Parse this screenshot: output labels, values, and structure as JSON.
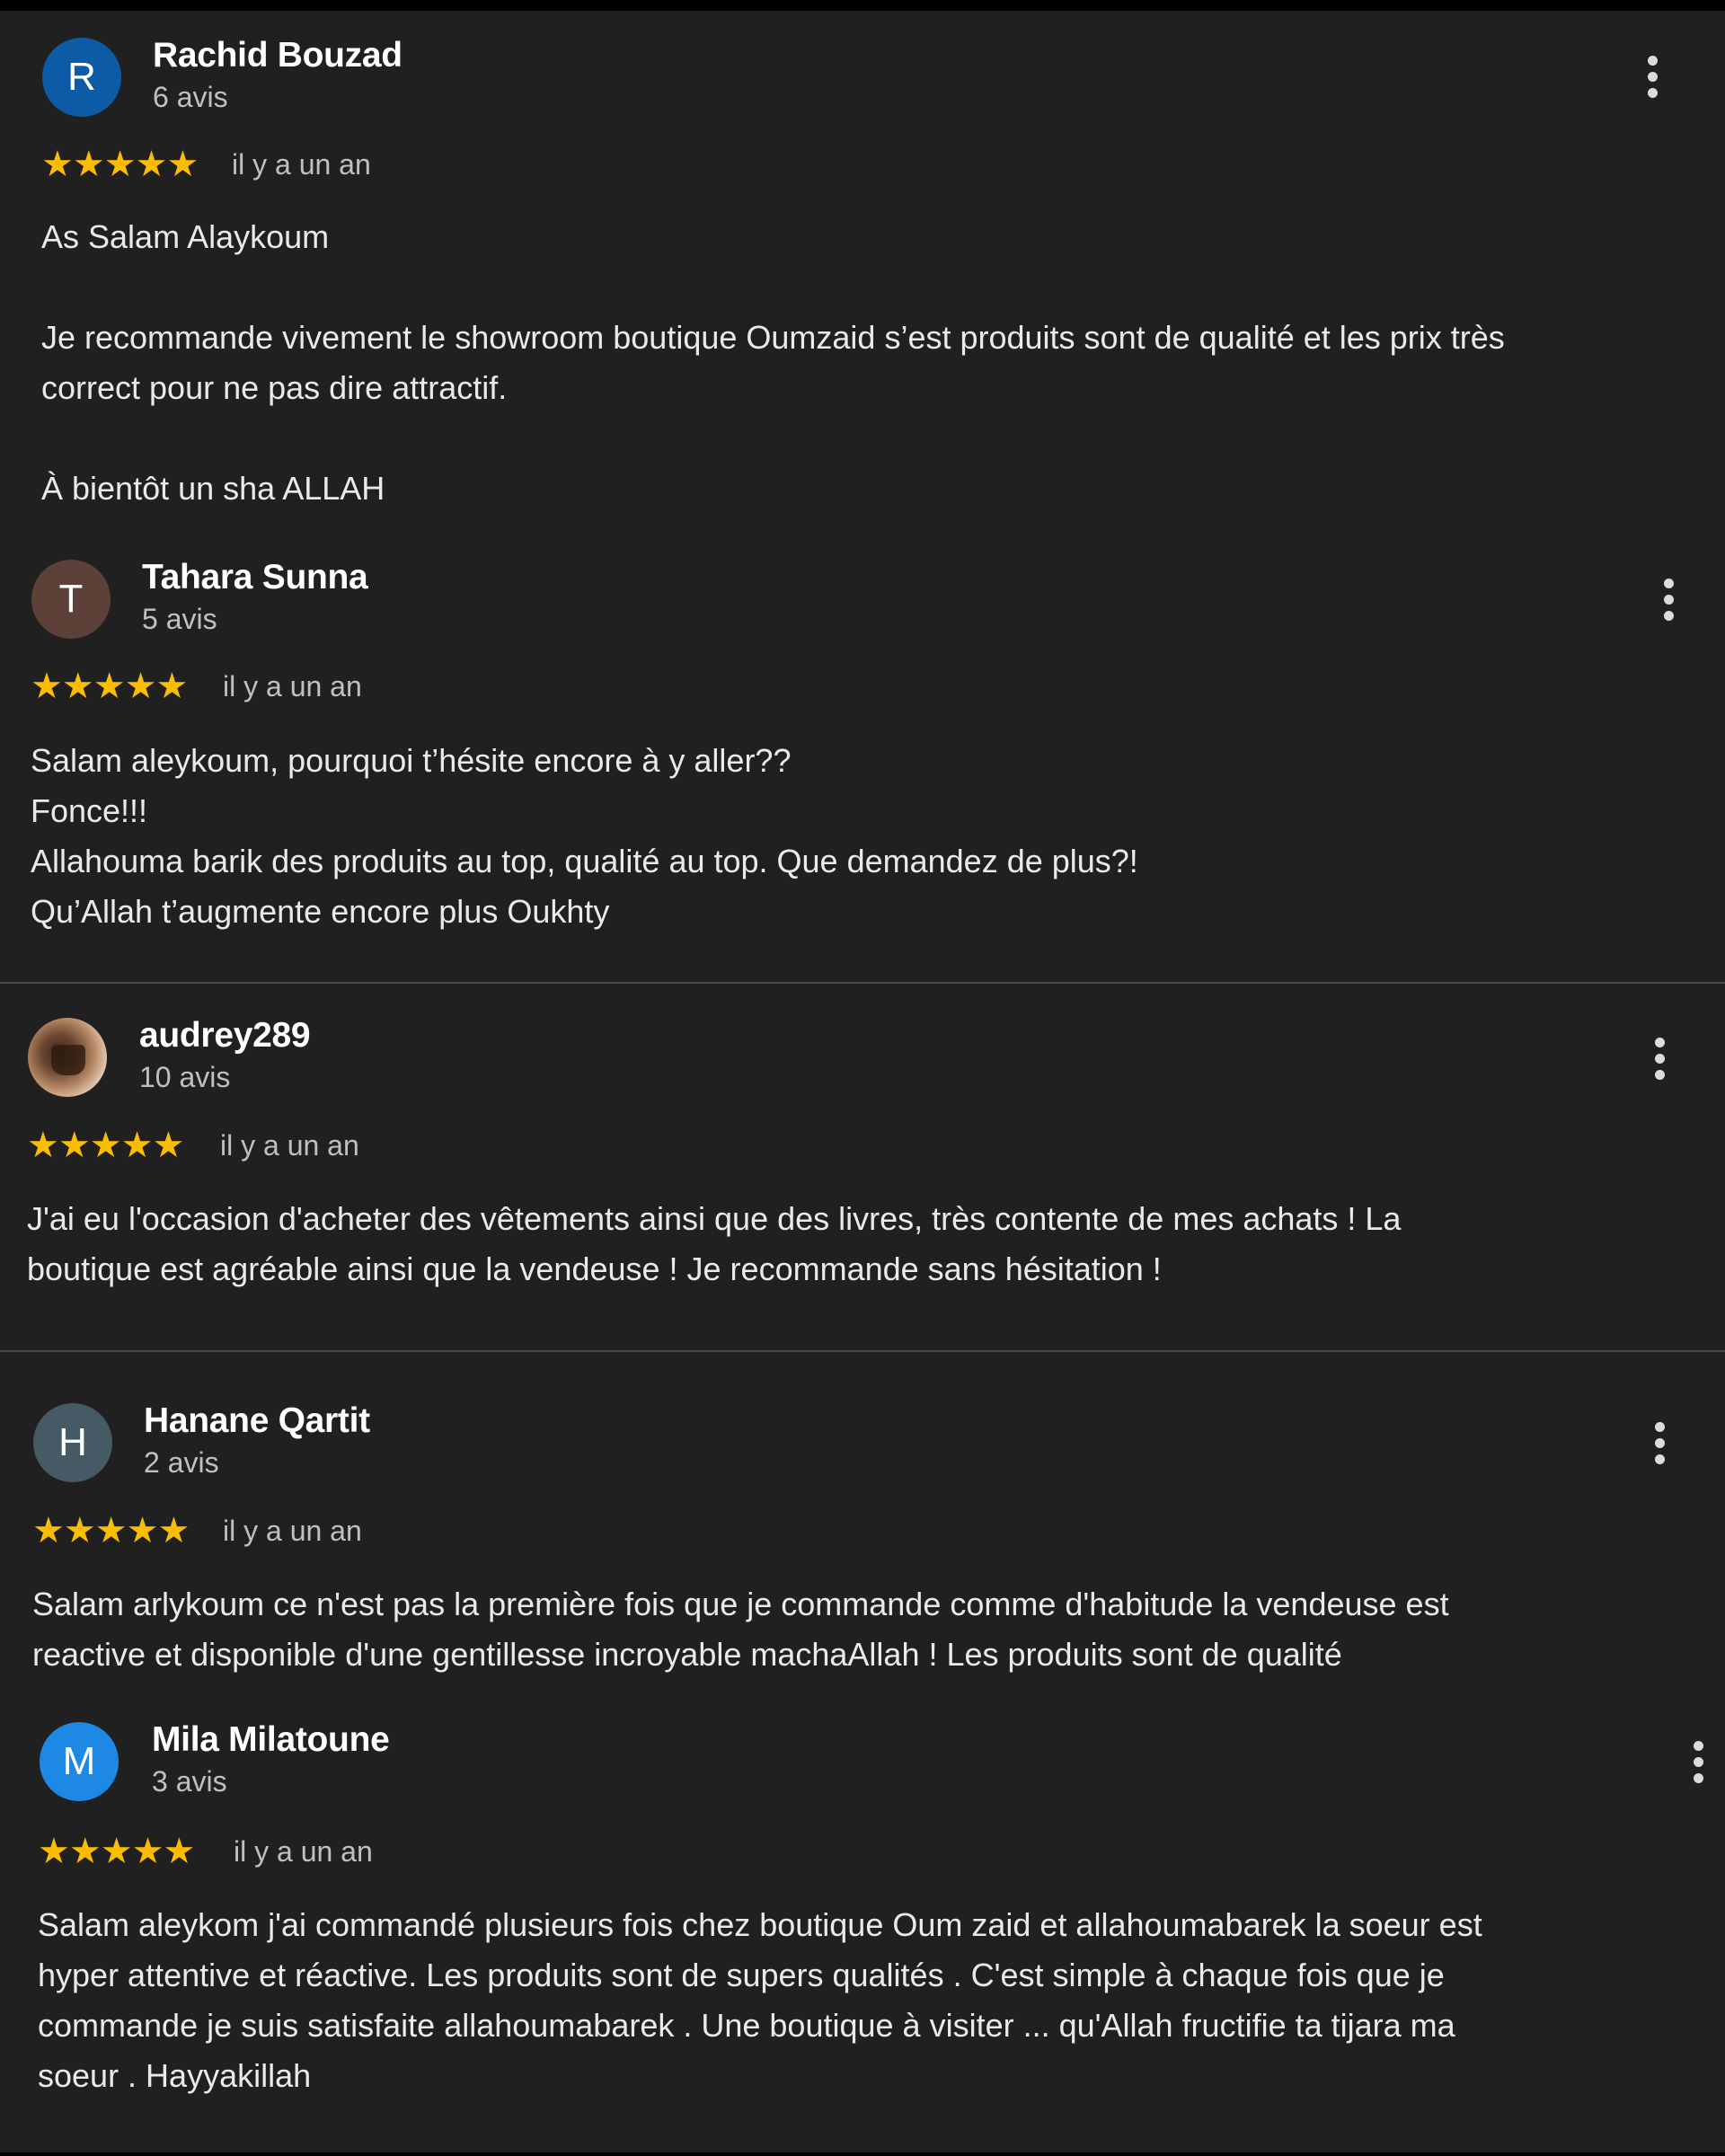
{
  "colors": {
    "background": "#202020",
    "star": "#fbbc04",
    "avatar_r": "#0d5aa7",
    "avatar_t": "#5d4037",
    "avatar_h": "#455a64",
    "avatar_m": "#1e88e5"
  },
  "reviews": [
    {
      "initial": "R",
      "name": "Rachid Bouzad",
      "count": "6 avis",
      "stars": "★★★★★",
      "rating": 5,
      "date": "il y a un an",
      "lines": [
        "As Salam Alaykoum",
        "",
        "Je recommande vivement le showroom boutique Oumzaid s’est produits sont de qualité et les prix très",
        "correct pour ne pas dire attractif.",
        "",
        "À bientôt un sha ALLAH"
      ]
    },
    {
      "initial": "T",
      "name": "Tahara Sunna",
      "count": "5 avis",
      "stars": "★★★★★",
      "rating": 5,
      "date": "il y a un an",
      "lines": [
        "Salam aleykoum, pourquoi t’hésite encore à y aller??",
        "Fonce!!!",
        "Allahouma barik des produits au top, qualité au top. Que demandez de plus?!",
        "Qu’Allah t’augmente encore plus Oukhty"
      ]
    },
    {
      "initial": "",
      "name": "audrey289",
      "count": "10 avis",
      "stars": "★★★★★",
      "rating": 5,
      "date": "il y a un an",
      "lines": [
        "J'ai eu l'occasion d'acheter des vêtements ainsi que des livres, très contente de mes achats ! La",
        "boutique est agréable ainsi que la vendeuse ! Je recommande sans hésitation !"
      ]
    },
    {
      "initial": "H",
      "name": "Hanane Qartit",
      "count": "2 avis",
      "stars": "★★★★★",
      "rating": 5,
      "date": "il y a un an",
      "lines": [
        "Salam arlykoum ce n'est pas la première fois que je commande comme d'habitude la vendeuse est",
        "reactive et disponible d'une gentillesse incroyable machaAllah ! Les produits sont de qualité"
      ]
    },
    {
      "initial": "M",
      "name": "Mila Milatoune",
      "count": "3 avis",
      "stars": "★★★★★",
      "rating": 5,
      "date": "il y a un an",
      "lines": [
        "Salam aleykom j'ai commandé plusieurs fois chez boutique Oum zaid et allahoumabarek la soeur est",
        "hyper attentive et réactive. Les produits sont de supers qualités . C'est simple à chaque fois que je",
        "commande je suis satisfaite allahoumabarek . Une boutique à visiter ... qu'Allah fructifie ta tijara ma",
        "soeur . Hayyakillah"
      ]
    }
  ]
}
